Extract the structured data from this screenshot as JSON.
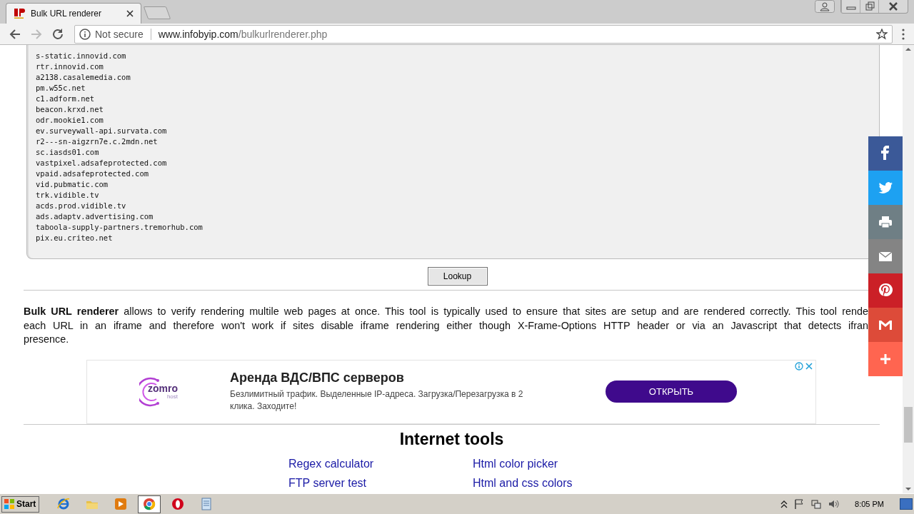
{
  "browser": {
    "tab": {
      "title": "Bulk URL renderer",
      "selected": true
    },
    "address": {
      "security": "Not secure",
      "host": "www.infobyip.com",
      "path": "/bulkurlrenderer.php"
    }
  },
  "page": {
    "url_list": [
      "s-static.innovid.com",
      "rtr.innovid.com",
      "a2138.casalemedia.com",
      "pm.w55c.net",
      "c1.adform.net",
      "beacon.krxd.net",
      "odr.mookie1.com",
      "ev.surveywall-api.survata.com",
      "r2---sn-aigzrn7e.c.2mdn.net",
      "sc.iasds01.com",
      "vastpixel.adsafeprotected.com",
      "vpaid.adsafeprotected.com",
      "vid.pubmatic.com",
      "trk.vidible.tv",
      "acds.prod.vidible.tv",
      "ads.adaptv.advertising.com",
      "taboola-supply-partners.tremorhub.com",
      "pix.eu.criteo.net"
    ],
    "lookup_button": "Lookup",
    "description_lines": [
      "**Bulk URL renderer** allows to verify rendering multile web pages at once. This tool is typically used to ensure that sites are setup and are rendered correctly. This tool rende",
      "each URL in an iframe and therefore won't work if sites disable iframe rendering either though X-Frame-Options HTTP header or via an Javascript that detects ifran",
      "presence."
    ],
    "ad": {
      "logo": "zomro",
      "logo_sub": "host",
      "title": "Аренда ВДС/ВПС серверов",
      "text": "Безлимитный трафик. Выделенные IP-адреса. Загрузка/Перезагрузка в 2 клика. Заходите!",
      "button": "ОТКРЫТЬ"
    },
    "tools": {
      "heading": "Internet tools",
      "links": [
        [
          "Regex calculator",
          "Html color picker"
        ],
        [
          "FTP server test",
          "Html and css colors"
        ]
      ]
    }
  },
  "share_bar": [
    {
      "kind": "facebook",
      "color": "#3b5998"
    },
    {
      "kind": "twitter",
      "color": "#1da1f2"
    },
    {
      "kind": "print",
      "color": "#6f7f85"
    },
    {
      "kind": "email",
      "color": "#848484"
    },
    {
      "kind": "pinterest",
      "color": "#cb2027"
    },
    {
      "kind": "gmail",
      "color": "#dd4b39"
    },
    {
      "kind": "more",
      "color": "#ff6550"
    }
  ],
  "taskbar": {
    "start": "Start",
    "apps": [
      {
        "kind": "ie",
        "selected": false
      },
      {
        "kind": "folder",
        "selected": false
      },
      {
        "kind": "media",
        "selected": false
      },
      {
        "kind": "chrome",
        "selected": true
      },
      {
        "kind": "opera",
        "selected": false
      },
      {
        "kind": "notepad",
        "selected": false
      }
    ],
    "clock": "8:05 PM"
  }
}
